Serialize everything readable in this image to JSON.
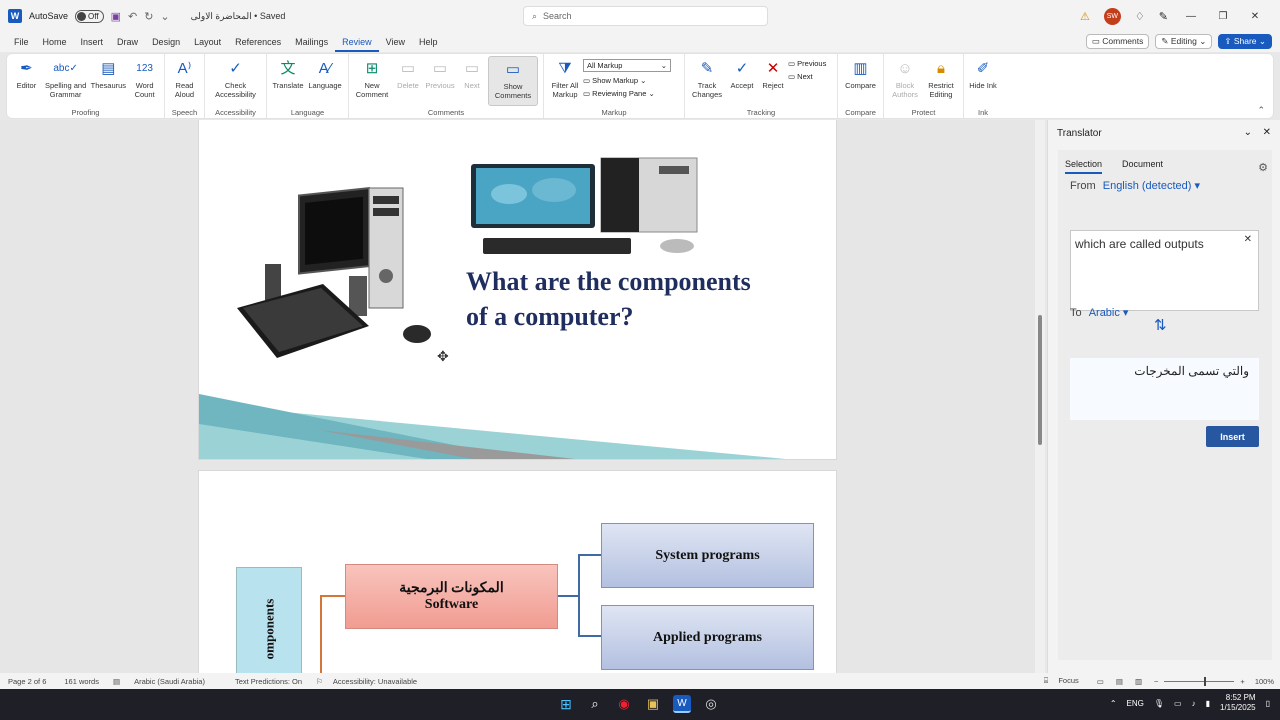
{
  "titlebar": {
    "autosave_label": "AutoSave",
    "autosave_state": "Off",
    "document_title": "المحاضرة الاولى • Saved",
    "search_placeholder": "Search",
    "avatar_initials": "SW"
  },
  "tabs": [
    "File",
    "Home",
    "Insert",
    "Draw",
    "Design",
    "Layout",
    "References",
    "Mailings",
    "Review",
    "View",
    "Help"
  ],
  "active_tab": "Review",
  "tab_actions": {
    "comments": "Comments",
    "editing": "Editing",
    "share": "Share"
  },
  "ribbon": {
    "proofing": {
      "name": "Proofing",
      "buttons": [
        "Editor",
        "Spelling and Grammar",
        "Thesaurus",
        "Word Count"
      ]
    },
    "speech": {
      "name": "Speech",
      "buttons": [
        "Read Aloud"
      ]
    },
    "accessibility": {
      "name": "Accessibility",
      "buttons": [
        "Check Accessibility"
      ]
    },
    "language": {
      "name": "Language",
      "buttons": [
        "Translate",
        "Language"
      ]
    },
    "comments": {
      "name": "Comments",
      "buttons": [
        "New Comment",
        "Delete",
        "Previous",
        "Next",
        "Show Comments"
      ]
    },
    "markup": {
      "name": "Markup",
      "filter": "Filter All Markup",
      "display_value": "All Markup",
      "show_markup": "Show Markup",
      "reviewing_pane": "Reviewing Pane"
    },
    "tracking": {
      "name": "Tracking",
      "buttons": [
        "Track Changes",
        "Accept",
        "Reject"
      ],
      "previous": "Previous",
      "next": "Next"
    },
    "compare": {
      "name": "Compare",
      "buttons": [
        "Compare"
      ]
    },
    "protect": {
      "name": "Protect",
      "buttons": [
        "Block Authors",
        "Restrict Editing"
      ]
    },
    "ink": {
      "name": "Ink",
      "buttons": [
        "Hide Ink"
      ]
    }
  },
  "document": {
    "heading_line1": "What are the components",
    "heading_line2": "of a computer?",
    "box_software_ar": "المكونات البرمجية",
    "box_software_en": "Software",
    "box_system": "System programs",
    "box_applied": "Applied programs",
    "vertical_label": "omponents"
  },
  "translator": {
    "title": "Translator",
    "tab_selection": "Selection",
    "tab_document": "Document",
    "from_label": "From",
    "from_lang": "English (detected)",
    "source_text": "which are called outputs",
    "to_label": "To",
    "to_lang": "Arabic",
    "target_text": "والتي تسمى المخرجات",
    "insert_label": "Insert"
  },
  "statusbar": {
    "page": "Page 2 of 6",
    "words": "161 words",
    "language": "Arabic (Saudi Arabia)",
    "text_predictions": "Text Predictions: On",
    "accessibility": "Accessibility: Unavailable",
    "focus": "Focus",
    "zoom": "100%"
  },
  "taskbar": {
    "lang": "ENG",
    "time": "8:52 PM",
    "date": "1/15/2025"
  },
  "colors": {
    "accent": "#185abd",
    "heading": "#1f2e5e",
    "software_box": "#f4b5ad",
    "program_box": "#c5cfe6"
  }
}
